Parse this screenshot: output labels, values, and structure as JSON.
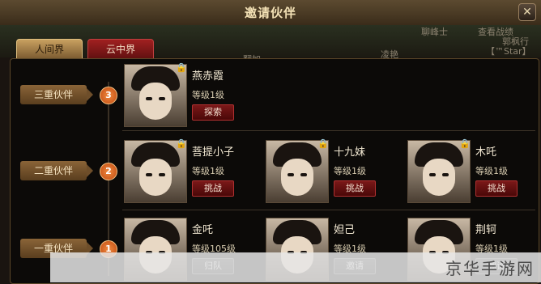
{
  "window": {
    "title": "邀请伙伴",
    "close": "✕"
  },
  "background_text": [
    "聊峰士",
    "查看战绩",
    "郭枫行",
    "【™Star】",
    "翻加",
    "凌艳"
  ],
  "tabs": [
    {
      "label": "人间界",
      "active": true
    },
    {
      "label": "云中界",
      "active": false
    }
  ],
  "tiers": [
    {
      "label": "三重伙伴",
      "number": "3",
      "partners": [
        {
          "name": "燕赤霞",
          "level": "等级1级",
          "action": "探索",
          "locked": true,
          "lock_icon": "lock-icon"
        }
      ]
    },
    {
      "label": "二重伙伴",
      "number": "2",
      "partners": [
        {
          "name": "菩提小子",
          "level": "等级1级",
          "action": "挑战",
          "locked": true,
          "lock_icon": "lock-icon"
        },
        {
          "name": "十九妹",
          "level": "等级1级",
          "action": "挑战",
          "locked": true,
          "lock_icon": "lock-icon"
        },
        {
          "name": "木吒",
          "level": "等级1级",
          "action": "挑战",
          "locked": true,
          "lock_icon": "lock-icon"
        }
      ]
    },
    {
      "label": "一重伙伴",
      "number": "1",
      "partners": [
        {
          "name": "金吒",
          "level": "等级105级",
          "action": "归队",
          "locked": false
        },
        {
          "name": "妲己",
          "level": "等级1级",
          "action": "邀请",
          "locked": false
        },
        {
          "name": "荆轲",
          "level": "等级1级",
          "action": "邀请",
          "locked": false
        }
      ]
    }
  ],
  "watermark": "京华手游网",
  "colors": {
    "accent": "#f08a40",
    "button_red": "#7a1818",
    "tab_active": "#c8a060",
    "tab_inactive": "#a02020"
  }
}
